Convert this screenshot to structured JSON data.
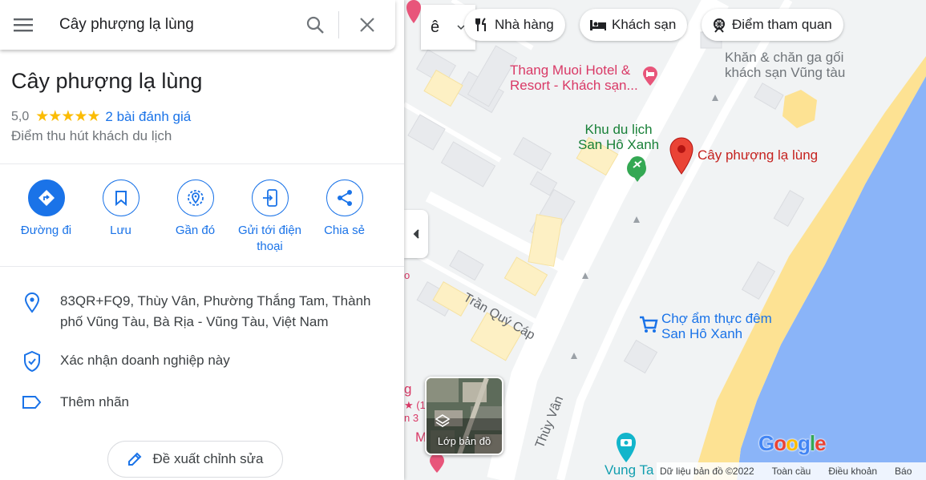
{
  "search": {
    "query": "Cây phượng lạ lùng",
    "menu_icon": "menu-icon",
    "search_icon": "search-icon",
    "close_icon": "close-icon"
  },
  "place": {
    "title": "Cây phượng lạ lùng",
    "rating": "5,0",
    "stars": "★★★★★",
    "reviews": "2 bài đánh giá",
    "category": "Điểm thu hút khách du lịch"
  },
  "actions": [
    {
      "label": "Đường đi",
      "icon": "directions-icon"
    },
    {
      "label": "Lưu",
      "icon": "bookmark-icon"
    },
    {
      "label": "Gần đó",
      "icon": "nearby-icon"
    },
    {
      "label": "Gửi tới điện thoại",
      "icon": "send-to-phone-icon"
    },
    {
      "label": "Chia sẻ",
      "icon": "share-icon"
    }
  ],
  "info": {
    "address": "83QR+FQ9, Thùy Vân, Phường Thắng Tam, Thành phố Vũng Tàu, Bà Rịa - Vũng Tàu, Việt Nam",
    "claim": "Xác nhận doanh nghiệp này",
    "label": "Thêm nhãn"
  },
  "suggest_edit": "Đề xuất chỉnh sửa",
  "map": {
    "chips": [
      {
        "label": "Nhà hàng",
        "icon": "restaurant-icon"
      },
      {
        "label": "Khách sạn",
        "icon": "hotel-icon"
      },
      {
        "label": "Điểm tham quan",
        "icon": "attraction-icon"
      }
    ],
    "chip_edge": "ê",
    "labels": {
      "hotel_1": "Thang Muoi Hotel &",
      "hotel_2": "Resort - Khách sạn...",
      "towels_1": "Khăn & chăn ga gối",
      "towels_2": "khách sạn Vũng tàu",
      "park_1": "Khu du lịch",
      "park_2": "San Hô Xanh",
      "pin": "Cây phượng lạ lùng",
      "market_1": "Chợ ẩm thực đêm",
      "market_2": "San Hô Xanh",
      "street_1": "Trần Quý Cáp",
      "street_2": "Thùy Vân",
      "vungtau": "Vung Ta",
      "edge_o": "o",
      "edge_g": "g",
      "edge_1": "(1",
      "edge_3": "n 3",
      "edge_m": "M"
    },
    "layer_label": "Lớp bản đồ",
    "google": "Google",
    "footer": [
      "Dữ liệu bản đồ ©2022",
      "Toàn cầu",
      "Điều khoản",
      "Báo"
    ],
    "colors": {
      "sea": "#8ab4f8",
      "sand": "#fde293",
      "land": "#f1f3f4",
      "road": "#ffffff",
      "building": "#e8eaed",
      "accent": "#1a73e8",
      "pin": "#ea4335"
    }
  }
}
